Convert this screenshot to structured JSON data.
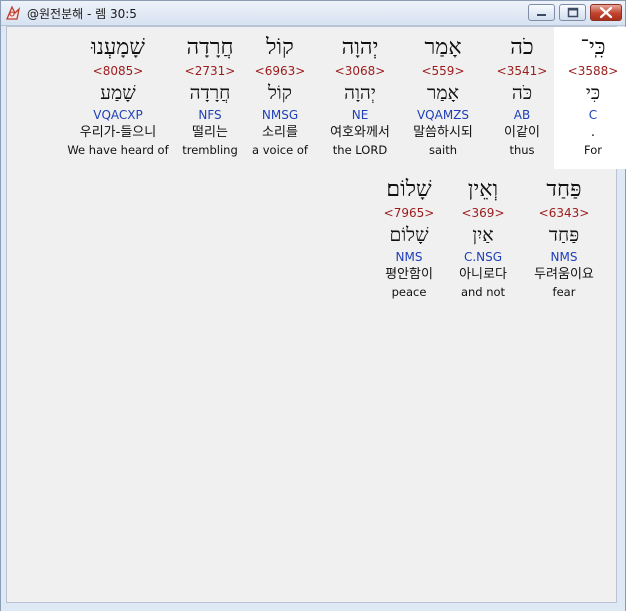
{
  "window": {
    "title": "@원전분해 - 렘 30:5",
    "buttons": {
      "minimize": "minimize",
      "maximize": "maximize",
      "close": "close"
    }
  },
  "words": [
    {
      "hebrew": "כִּֽי־",
      "strong": "<3588>",
      "lemma": "כִּי",
      "parse": "C",
      "korean": ".",
      "english": "For"
    },
    {
      "hebrew": "כֹה",
      "strong": "<3541>",
      "lemma": "כֹּה",
      "parse": "AB",
      "korean": "이같이",
      "english": "thus"
    },
    {
      "hebrew": "אָמַר",
      "strong": "<559>",
      "lemma": "אָמַר",
      "parse": "VQAMZS",
      "korean": "말씀하시되",
      "english": "saith"
    },
    {
      "hebrew": "יְהוָה",
      "strong": "<3068>",
      "lemma": "יְהוָה",
      "parse": "NE",
      "korean": "여호와께서",
      "english": "the LORD"
    },
    {
      "hebrew": "קוֹל",
      "strong": "<6963>",
      "lemma": "קוֹל",
      "parse": "NMSG",
      "korean": "소리를",
      "english": "a voice of"
    },
    {
      "hebrew": "חֲרָדָה",
      "strong": "<2731>",
      "lemma": "חֲרָדָה",
      "parse": "NFS",
      "korean": "떨리는",
      "english": "trembling"
    },
    {
      "hebrew": "שָׁמָעְנוּ",
      "strong": "<8085>",
      "lemma": "שָׁמַע",
      "parse": "VQACXP",
      "korean": "우리가-들으니",
      "english": "We have heard of"
    },
    {
      "hebrew": "פַּחַד",
      "strong": "<6343>",
      "lemma": "פַּחַד",
      "parse": "NMS",
      "korean": "두려움이요",
      "english": "fear"
    },
    {
      "hebrew": "וְאֵין",
      "strong": "<369>",
      "lemma": "אַיִן",
      "parse": "C.NSG",
      "korean": "아니로다",
      "english": "and not"
    },
    {
      "hebrew": "שָׁלוֹם׃",
      "strong": "<7965>",
      "lemma": "שָׁלוֹם",
      "parse": "NMS",
      "korean": "평안함이",
      "english": "peace"
    }
  ],
  "colors": {
    "strong": "#9b1b1b",
    "parse": "#1e3fb8",
    "highlight": "#ffffff",
    "content_bg": "#f0f0f0"
  }
}
